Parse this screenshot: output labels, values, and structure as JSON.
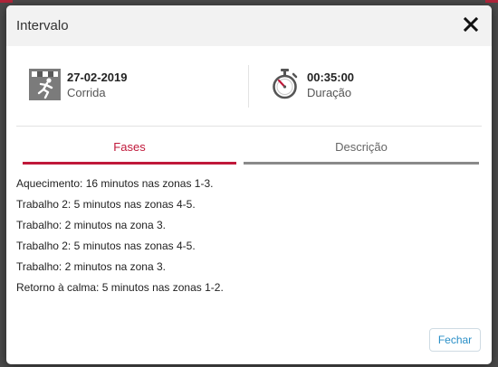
{
  "modal": {
    "title": "Intervalo",
    "close_icon": "close-icon",
    "footer_close_label": "Fechar"
  },
  "info": {
    "date": {
      "icon": "running-figure-icon",
      "value": "27-02-2019",
      "label": "Corrida"
    },
    "duration": {
      "icon": "stopwatch-icon",
      "value": "00:35:00",
      "label": "Duração"
    }
  },
  "tabs": [
    {
      "label": "Fases",
      "active": true
    },
    {
      "label": "Descrição",
      "active": false
    }
  ],
  "phases": [
    "Aquecimento: 16 minutos nas zonas 1-3.",
    "Trabalho 2: 5 minutos nas zonas 4-5.",
    "Trabalho: 2 minutos na zona 3.",
    "Trabalho 2: 5 minutos nas zonas 4-5.",
    "Trabalho: 2 minutos na zona 3.",
    "Retorno à calma: 5 minutos nas zonas 1-2."
  ],
  "colors": {
    "accent": "#c0183a",
    "link": "#2a8fc7",
    "header_bg": "#f2f2f2",
    "inactive_tab": "#8a8a8a"
  }
}
